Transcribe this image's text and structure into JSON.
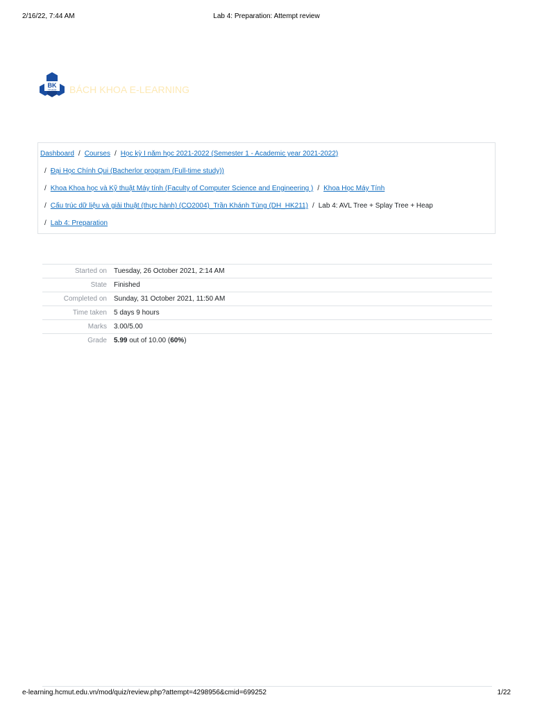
{
  "print": {
    "date": "2/16/22, 7:44 AM",
    "title": "Lab 4: Preparation: Attempt review",
    "url": "e-learning.hcmut.edu.vn/mod/quiz/review.php?attempt=4298956&cmid=699252",
    "page": "1/22"
  },
  "brand": {
    "name": "BÁCH KHOA E-LEARNING",
    "logo_text": "BK",
    "logo_sub": "TP.HCM",
    "logo_color": "#1a4ea1"
  },
  "breadcrumb": {
    "dashboard": "Dashboard",
    "courses": "Courses",
    "semester": "Học kỳ I năm học 2021-2022 (Semester 1 - Academic year 2021-2022)",
    "program": "Đại Học Chính Qui (Bacherlor program (Full-time study))",
    "faculty": "Khoa Khoa học và Kỹ thuật Máy tính (Faculty of Computer Science and Engineering )",
    "department": "Khoa Học Máy Tính",
    "course": "Cấu trúc dữ liệu và giải thuật (thực hành) (CO2004)_Trần Khánh Tùng (DH_HK211)",
    "section": "Lab 4: AVL Tree + Splay Tree + Heap",
    "quiz": "Lab 4: Preparation",
    "separator": "/"
  },
  "summary": {
    "started_label": "Started on",
    "started_value": "Tuesday, 26 October 2021, 2:14 AM",
    "state_label": "State",
    "state_value": "Finished",
    "completed_label": "Completed on",
    "completed_value": "Sunday, 31 October 2021, 11:50 AM",
    "time_label": "Time taken",
    "time_value": "5 days 9 hours",
    "marks_label": "Marks",
    "marks_value": "3.00/5.00",
    "grade_label": "Grade",
    "grade_score": "5.99",
    "grade_mid": " out of 10.00 (",
    "grade_percent": "60%",
    "grade_end": ")"
  }
}
